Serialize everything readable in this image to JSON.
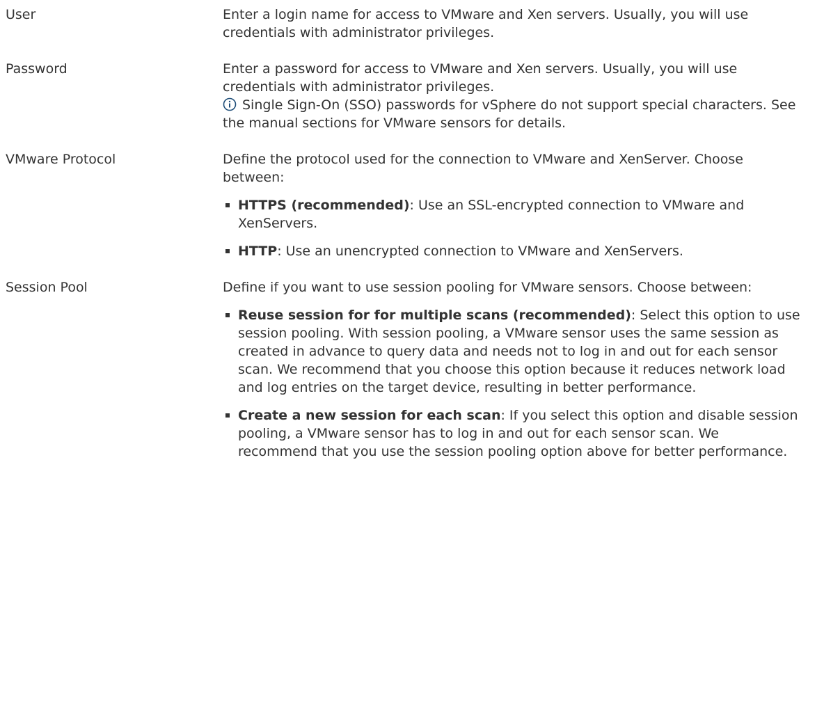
{
  "rows": [
    {
      "label": "User",
      "text": "Enter a login name for access to VMware and Xen servers. Usually, you will use credentials with administrator privileges."
    },
    {
      "label": "Password",
      "text": "Enter a password for access to VMware and Xen servers. Usually, you will use credentials with administrator privileges.",
      "note": "Single Sign-On (SSO) passwords for vSphere do not support special characters. See the manual sections for VMware sensors for details.",
      "note_icon": "info-icon"
    },
    {
      "label": "VMware Protocol",
      "text": "Define the protocol used for the connection to VMware and XenServer. Choose between:",
      "options": [
        {
          "name": "HTTPS (recommended)",
          "desc": ": Use an SSL-encrypted connection to VMware and XenServers."
        },
        {
          "name": "HTTP",
          "desc": ": Use an unencrypted connection to VMware and XenServers."
        }
      ]
    },
    {
      "label": "Session Pool",
      "text": "Define if you want to use session pooling for VMware sensors. Choose between:",
      "options": [
        {
          "name": "Reuse session for for multiple scans (recommended)",
          "desc": ": Select this option to use session pooling. With session pooling, a VMware sensor uses the same session as created in advance to query data and needs not to log in and out for each sensor scan. We recommend that you choose this option because it reduces network load and log entries on the target device, resulting in better performance."
        },
        {
          "name": "Create a new session for each scan",
          "desc": ": If you select this option and disable session pooling, a VMware sensor has to log in and out for each sensor scan. We recommend that you use the session pooling option above for better performance."
        }
      ]
    }
  ],
  "colors": {
    "text": "#333333",
    "icon": "#1f4e79"
  }
}
